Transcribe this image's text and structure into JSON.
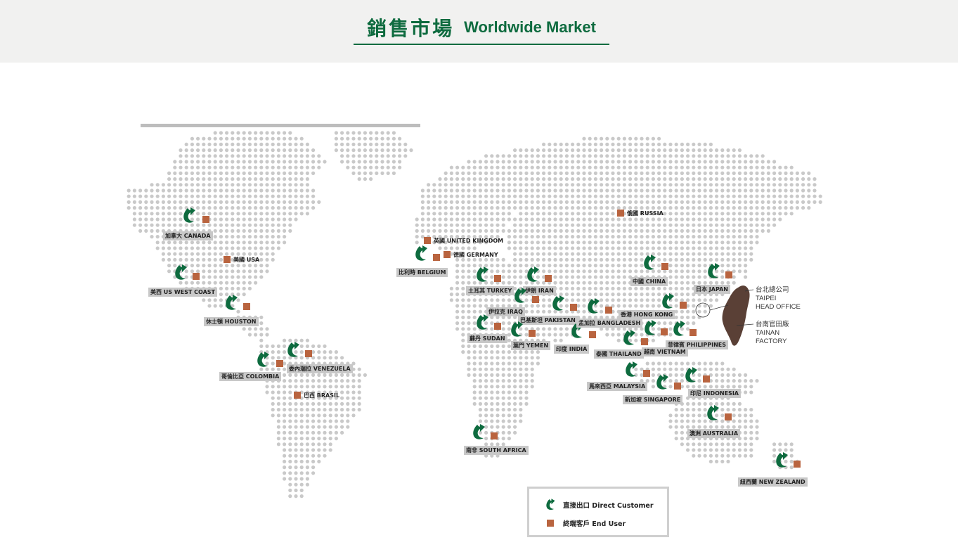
{
  "header": {
    "title_zh": "銷售市場",
    "title_en": "Worldwide Market"
  },
  "colors": {
    "brand_green": "#0e6b3f",
    "end_user": "#b9643f",
    "dots": "#c9c9c9",
    "taiwan": "#5a4036"
  },
  "locations": [
    {
      "id": "canada",
      "label": "加拿大 CANADA",
      "direct": true,
      "end": true
    },
    {
      "id": "usa",
      "label": "美國 USA",
      "direct": false,
      "end": true
    },
    {
      "id": "us-west-coast",
      "label": "美西 US WEST COAST",
      "direct": true,
      "end": true
    },
    {
      "id": "houston",
      "label": "休士頓 HOUSTON",
      "direct": true,
      "end": true
    },
    {
      "id": "colombia",
      "label": "哥倫比亞 COLOMBIA",
      "direct": true,
      "end": true
    },
    {
      "id": "venezuela",
      "label": "委內瑞拉 VENEZUELA",
      "direct": true,
      "end": true
    },
    {
      "id": "brasil",
      "label": "巴西 BRASIL",
      "direct": false,
      "end": true
    },
    {
      "id": "united-kingdom",
      "label": "英國 UNITED KINGDOM",
      "direct": false,
      "end": true
    },
    {
      "id": "germany",
      "label": "德國 GERMANY",
      "direct": false,
      "end": true
    },
    {
      "id": "belgium",
      "label": "比利時 BELGIUM",
      "direct": true,
      "end": true
    },
    {
      "id": "russia",
      "label": "俄國 RUSSIA",
      "direct": false,
      "end": true
    },
    {
      "id": "turkey",
      "label": "土耳其 TURKEY",
      "direct": true,
      "end": true
    },
    {
      "id": "iran",
      "label": "伊朗 IRAN",
      "direct": true,
      "end": true
    },
    {
      "id": "iraq",
      "label": "伊拉克 IRAQ",
      "direct": true,
      "end": true
    },
    {
      "id": "pakistan",
      "label": "巴基斯坦 PAKISTAN",
      "direct": true,
      "end": true
    },
    {
      "id": "sudan",
      "label": "蘇丹 SUDAN",
      "direct": true,
      "end": true
    },
    {
      "id": "yemen",
      "label": "葉門 YEMEN",
      "direct": true,
      "end": true
    },
    {
      "id": "india",
      "label": "印度 INDIA",
      "direct": true,
      "end": true
    },
    {
      "id": "bangladesh",
      "label": "孟加拉 BANGLADESH",
      "direct": true,
      "end": true
    },
    {
      "id": "china",
      "label": "中國 CHINA",
      "direct": true,
      "end": true
    },
    {
      "id": "japan",
      "label": "日本 JAPAN",
      "direct": true,
      "end": true
    },
    {
      "id": "hong-kong",
      "label": "香港 HONG KONG",
      "direct": true,
      "end": true
    },
    {
      "id": "thailand",
      "label": "泰國 THAILAND",
      "direct": true,
      "end": true
    },
    {
      "id": "vietnam",
      "label": "越南 VIETNAM",
      "direct": true,
      "end": true
    },
    {
      "id": "philippines",
      "label": "菲律賓 PHILIPPINES",
      "direct": true,
      "end": true
    },
    {
      "id": "malaysia",
      "label": "馬來西亞 MALAYSIA",
      "direct": true,
      "end": true
    },
    {
      "id": "singapore",
      "label": "新加坡 SINGAPORE",
      "direct": true,
      "end": true
    },
    {
      "id": "indonesia",
      "label": "印尼 INDONESIA",
      "direct": true,
      "end": true
    },
    {
      "id": "south-africa",
      "label": "南非 SOUTH AFRICA",
      "direct": true,
      "end": true
    },
    {
      "id": "australia",
      "label": "澳洲 AUSTRALIA",
      "direct": true,
      "end": true
    },
    {
      "id": "new-zealand",
      "label": "紐西蘭 NEW ZEALAND",
      "direct": true,
      "end": true
    }
  ],
  "taiwan": {
    "head_office_zh": "台北總公司",
    "head_office_en_1": "TAIPEI",
    "head_office_en_2": "HEAD OFFICE",
    "factory_zh": "台南官田廠",
    "factory_en_1": "TAINAN",
    "factory_en_2": "FACTORY"
  },
  "legend": {
    "direct_customer": "直接出口 Direct Customer",
    "end_user": "終端客戶 End User"
  }
}
